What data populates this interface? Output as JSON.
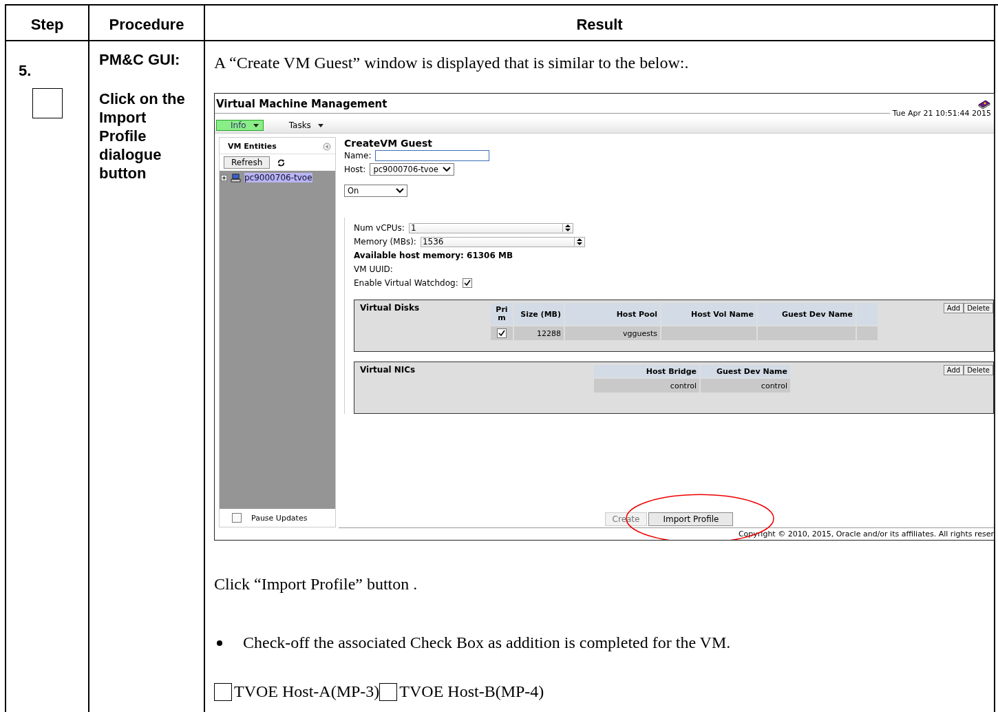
{
  "table": {
    "columns": [
      "Step",
      "Procedure",
      "Result"
    ],
    "step": {
      "number": "5.",
      "checked": false
    },
    "procedure": {
      "heading": "PM&C GUI:",
      "instruction": "Click on the Import Profile dialogue button"
    },
    "result": {
      "intro": "A “Create VM Guest” window is displayed that is similar to the below:.",
      "screenshot": {
        "title": "Virtual Machine Management",
        "datetime": "Tue Apr 21 10:51:44 2015",
        "menu": [
          {
            "label": "Info",
            "selected": true
          },
          {
            "label": "Tasks",
            "selected": false
          }
        ],
        "sidebar": {
          "title": "VM Entities",
          "refresh": "Refresh",
          "tree": [
            {
              "label": "pc9000706-tvoe",
              "selected": true,
              "expanded": false
            }
          ],
          "pause": {
            "label": "Pause Updates",
            "checked": false
          }
        },
        "form": {
          "title": "CreateVM Guest",
          "name": {
            "label": "Name:"
          },
          "host": {
            "label": "Host:",
            "value": "pc9000706-tvoe"
          },
          "power": {
            "value": "On"
          },
          "vcpus": {
            "label": "Num vCPUs:",
            "value": "1"
          },
          "memory": {
            "label": "Memory (MBs):",
            "value": "1536"
          },
          "available": "Available host memory: 61306 MB",
          "uuid": "VM UUID:",
          "watchdog": {
            "label": "Enable Virtual Watchdog:",
            "checked": true
          }
        },
        "disks": {
          "title": "Virtual Disks",
          "columns": [
            "Prim",
            "Size (MB)",
            "Host Pool",
            "Host Vol Name",
            "Guest Dev Name"
          ],
          "rows": [
            {
              "prim": true,
              "size": "12288",
              "host_pool": "vgguests"
            }
          ],
          "buttons": [
            "Add",
            "Delete"
          ]
        },
        "nics": {
          "title": "Virtual NICs",
          "columns": [
            "Host Bridge",
            "Guest Dev Name"
          ],
          "rows": [
            [
              "control",
              "control"
            ]
          ],
          "buttons": [
            "Add",
            "Delete"
          ]
        },
        "footer_buttons": [
          {
            "label": "Create",
            "disabled": true,
            "circled": false
          },
          {
            "label": "Import Profile",
            "disabled": false,
            "circled": true
          }
        ],
        "copyright": "Copyright © 2010, 2015, Oracle and/or its affiliates. All rights reser"
      },
      "instruction": "Click “Import Profile” button .",
      "bullets": [
        "Check-off the associated Check Box as addition is completed for the VM."
      ],
      "checkboxes": [
        {
          "label": "TVOE Host-A(MP-3)",
          "checked": false
        },
        {
          "label": "TVOE Host-B(MP-4)",
          "checked": false
        }
      ]
    }
  }
}
